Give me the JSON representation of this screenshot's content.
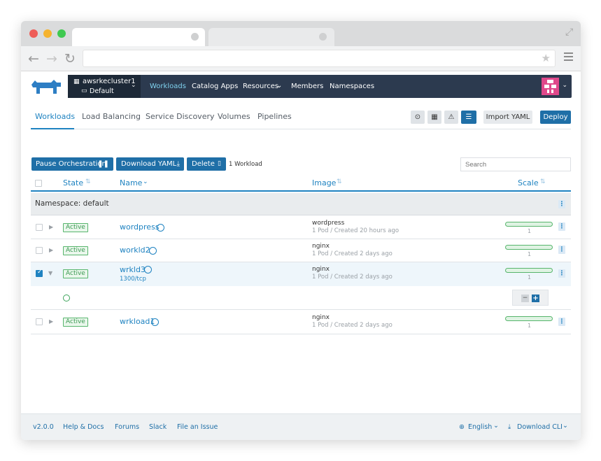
{
  "nav": {
    "cluster_name": "awsrkecluster1",
    "project_name": "Default",
    "items": [
      "Workloads",
      "Catalog Apps",
      "Resources",
      "Members",
      "Namespaces"
    ]
  },
  "subtabs": [
    "Workloads",
    "Load Balancing",
    "Service Discovery",
    "Volumes",
    "Pipelines"
  ],
  "toolbar": {
    "import_yaml": "Import YAML",
    "deploy": "Deploy",
    "pause": "Pause Orchestration",
    "download_yaml": "Download YAML",
    "delete": "Delete",
    "selection_count": "1 Workload",
    "search_placeholder": "Search"
  },
  "table": {
    "headers": {
      "state": "State",
      "name": "Name",
      "image": "Image",
      "scale": "Scale"
    },
    "namespace_label": "Namespace: default",
    "rows": [
      {
        "state": "Active",
        "name": "wordpress",
        "port": "",
        "image": "wordpress",
        "image_sub": "1 Pod / Created 20 hours ago",
        "scale": "1",
        "checked": false
      },
      {
        "state": "Active",
        "name": "workld2",
        "port": "",
        "image": "nginx",
        "image_sub": "1 Pod / Created 2 days ago",
        "scale": "1",
        "checked": false
      },
      {
        "state": "Active",
        "name": "wrkld3",
        "port": "1300/tcp",
        "image": "nginx",
        "image_sub": "1 Pod / Created 2 days ago",
        "scale": "1",
        "checked": true
      },
      {
        "state": "Active",
        "name": "wrkload1",
        "port": "",
        "image": "nginx",
        "image_sub": "1 Pod / Created 2 days ago",
        "scale": "1",
        "checked": false
      }
    ]
  },
  "footer": {
    "version": "v2.0.0",
    "help": "Help & Docs",
    "forums": "Forums",
    "slack": "Slack",
    "issue": "File an Issue",
    "language": "English",
    "download_cli": "Download CLI"
  },
  "colors": {
    "accent": "#1f83c1",
    "nav_bg": "#2c3a4f",
    "active_green": "#57b56c",
    "avatar": "#e0488b"
  }
}
